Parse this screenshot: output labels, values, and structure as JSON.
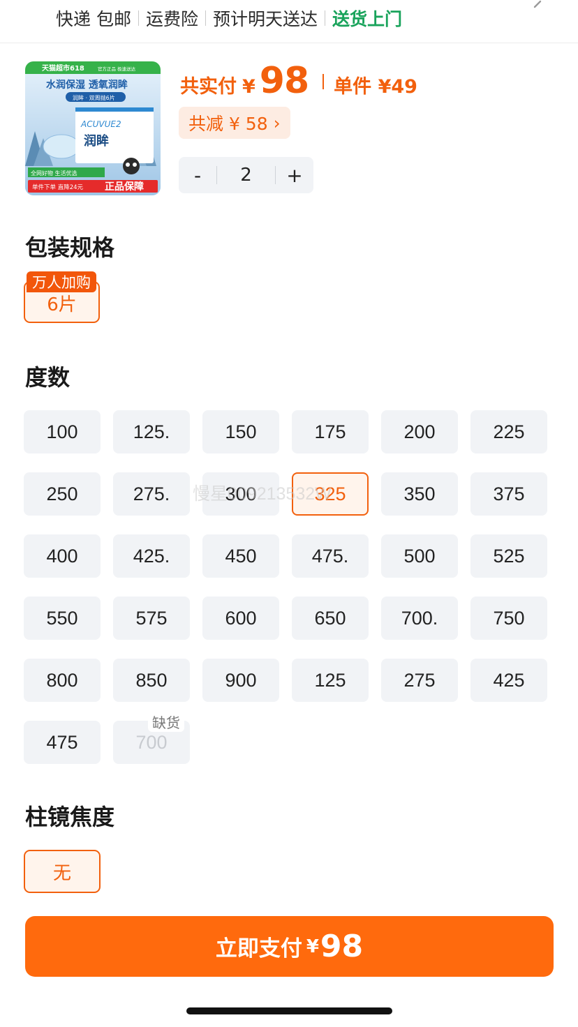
{
  "shipping": {
    "items": [
      "快递 包邮",
      "运费险",
      "预计明天送达"
    ],
    "highlight": "送货上门"
  },
  "product": {
    "thumb": {
      "top_banner": "天猫超市618",
      "top_banner_tail": "官方正品 极速送达",
      "headline": "水润保湿 透氧润眸",
      "subline": "润眸 · 双周抛6片",
      "brand": "ACUVUE2",
      "box_name": "润眸",
      "promo_1": "全网好物 生活优选",
      "promo_2": "单件下单 直降24元",
      "promo_badge": "正品保障"
    },
    "total_label": "共实付",
    "currency": "¥",
    "total_price": "98",
    "unit_label": "单件 ¥49",
    "discount_label": "共减 ¥ 58",
    "discount_arrow": "›",
    "qty_minus": "-",
    "qty_value": "2",
    "qty_plus": "+"
  },
  "package": {
    "title": "包装规格",
    "badge": "万人加购",
    "option": "6片"
  },
  "degree": {
    "title": "度数",
    "options": [
      "100",
      "125.",
      "150",
      "175",
      "200",
      "225",
      "250",
      "275.",
      "300",
      "325",
      "350",
      "375",
      "400",
      "425.",
      "450",
      "475.",
      "500",
      "525",
      "550",
      "575",
      "600",
      "650",
      "700.",
      "750",
      "800",
      "850",
      "900",
      "125",
      "275",
      "425",
      "475",
      "700"
    ],
    "selected": "325",
    "out_of_stock_label": "缺货",
    "out_of_stock": "700",
    "watermark": "慢星009213532W"
  },
  "cylinder": {
    "title": "柱镜焦度",
    "option": "无"
  },
  "pay": {
    "label": "立即支付",
    "currency": "¥",
    "amount": "98"
  },
  "colors": {
    "accent": "#f2600d",
    "button": "#ff6a0d",
    "green": "#19a35b",
    "chip_bg": "#f1f3f6"
  }
}
